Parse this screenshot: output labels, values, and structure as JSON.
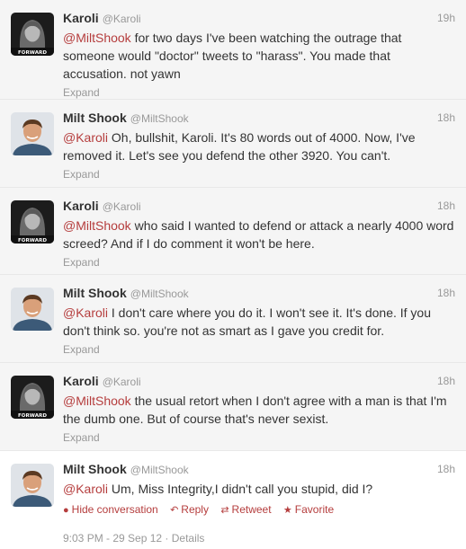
{
  "users": {
    "karoli": {
      "name": "Karoli",
      "handle": "@Karoli",
      "badge": "F✪RWARD"
    },
    "milt": {
      "name": "Milt Shook",
      "handle": "@MiltShook"
    }
  },
  "tweets": [
    {
      "time": "19h",
      "mention": "@MiltShook",
      "text": " for two days I've been watching the outrage that someone would \"doctor\" tweets to \"harass\". You made that accusation. not yawn",
      "expand": "Expand"
    },
    {
      "time": "18h",
      "mention": "@Karoli",
      "text": " Oh, bullshit, Karoli. It's 80 words out of 4000. Now, I've removed it. Let's see you defend the other 3920. You can't.",
      "expand": "Expand"
    },
    {
      "time": "18h",
      "mention": "@MiltShook",
      "text": " who said I wanted to defend or attack a nearly 4000 word screed? And if I do comment it won't be here.",
      "expand": "Expand"
    },
    {
      "time": "18h",
      "mention": "@Karoli",
      "text": " I don't care where you do it. I won't see it. It's done. If you don't think so. you're not as smart as I gave you credit for.",
      "expand": "Expand"
    },
    {
      "time": "18h",
      "mention": "@MiltShook",
      "text": " the usual retort when I don't agree with a man is that I'm the dumb one. But of course that's never sexist.",
      "expand": "Expand"
    },
    {
      "time": "18h",
      "mention": "@Karoli",
      "text": " Um, Miss Integrity,I didn't call you stupid, did I?"
    }
  ],
  "actions": {
    "hide_conversation": "Hide conversation",
    "reply": "Reply",
    "retweet": "Retweet",
    "favorite": "Favorite"
  },
  "meta": {
    "timestamp": "9:03 PM - 29 Sep 12",
    "separator": " · ",
    "details": "Details"
  },
  "colors": {
    "accent": "#b53d3d",
    "muted": "#999999",
    "text": "#333333",
    "row_background": "#f5f5f5"
  },
  "icons": {
    "hide_conversation": "speech-bubble-icon",
    "reply": "reply-arrow-icon",
    "retweet": "retweet-icon",
    "favorite": "star-icon"
  }
}
